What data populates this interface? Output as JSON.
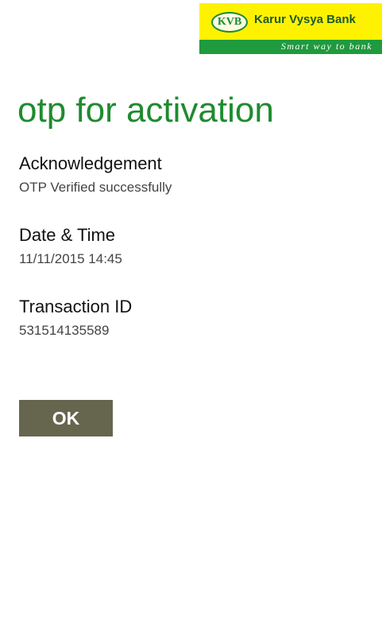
{
  "logo": {
    "badge": "KVB",
    "name": "Karur Vysya Bank",
    "tagline": "Smart way to bank"
  },
  "page": {
    "title": "otp for activation"
  },
  "fields": {
    "acknowledgement": {
      "label": "Acknowledgement",
      "value": "OTP Verified successfully"
    },
    "date_time": {
      "label": "Date & Time",
      "value": "11/11/2015 14:45"
    },
    "transaction_id": {
      "label": "Transaction ID",
      "value": "531514135589"
    }
  },
  "actions": {
    "ok_label": "OK"
  },
  "colors": {
    "title_green": "#1e8b2f",
    "logo_yellow": "#fff200",
    "logo_green": "#1f9a3d",
    "button_bg": "#66664f"
  }
}
